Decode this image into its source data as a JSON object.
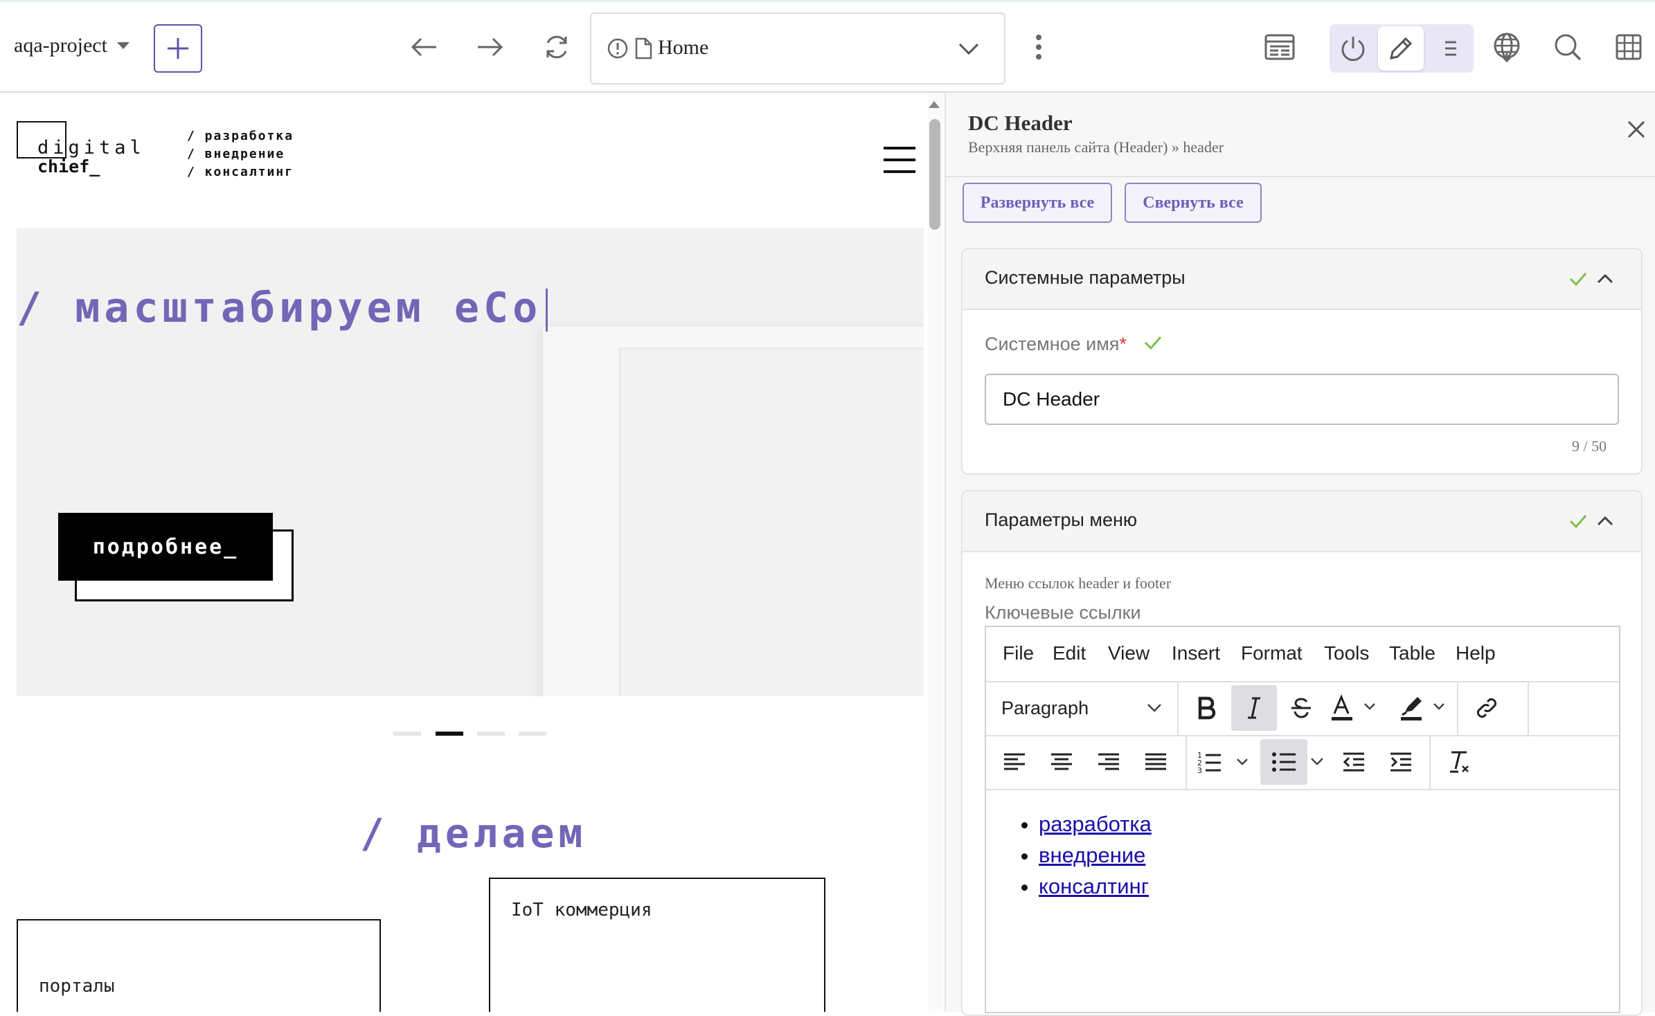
{
  "toolbar": {
    "project": "aqa-project",
    "address": "Home"
  },
  "site": {
    "logo_line1": "digital",
    "logo_line2": "chief_",
    "tags": [
      "/ разработка",
      "/ внедрение",
      "/ консалтинг"
    ],
    "hero_title": "/ масштабируем eCo",
    "hero_button": "подробнее_",
    "slides": {
      "count": 4,
      "active": 2
    },
    "section_title": "/ делаем",
    "cards": [
      "порталы",
      "IoT коммерция"
    ]
  },
  "panel": {
    "title": "DC Header",
    "subtitle": "Верхняя панель сайта (Header) » header",
    "expand_all": "Развернуть все",
    "collapse_all": "Свернуть все",
    "system_section": {
      "title": "Системные параметры",
      "field_label": "Системное имя",
      "required_mark": "*",
      "field_value": "DC Header",
      "counter": "9 / 50"
    },
    "menu_section": {
      "title": "Параметры меню",
      "description": "Меню ссылок header и footer",
      "field_label": "Ключевые ссылки",
      "editor": {
        "menu": [
          "File",
          "Edit",
          "View",
          "Insert",
          "Format",
          "Tools",
          "Table",
          "Help"
        ],
        "block_format": "Paragraph",
        "links": [
          "разработка",
          "внедрение",
          "консалтинг"
        ]
      }
    }
  },
  "colors": {
    "accent": "#7565b7",
    "button_border": "#5a55a8",
    "check": "#7cc04b",
    "link": "#1a0dab"
  }
}
